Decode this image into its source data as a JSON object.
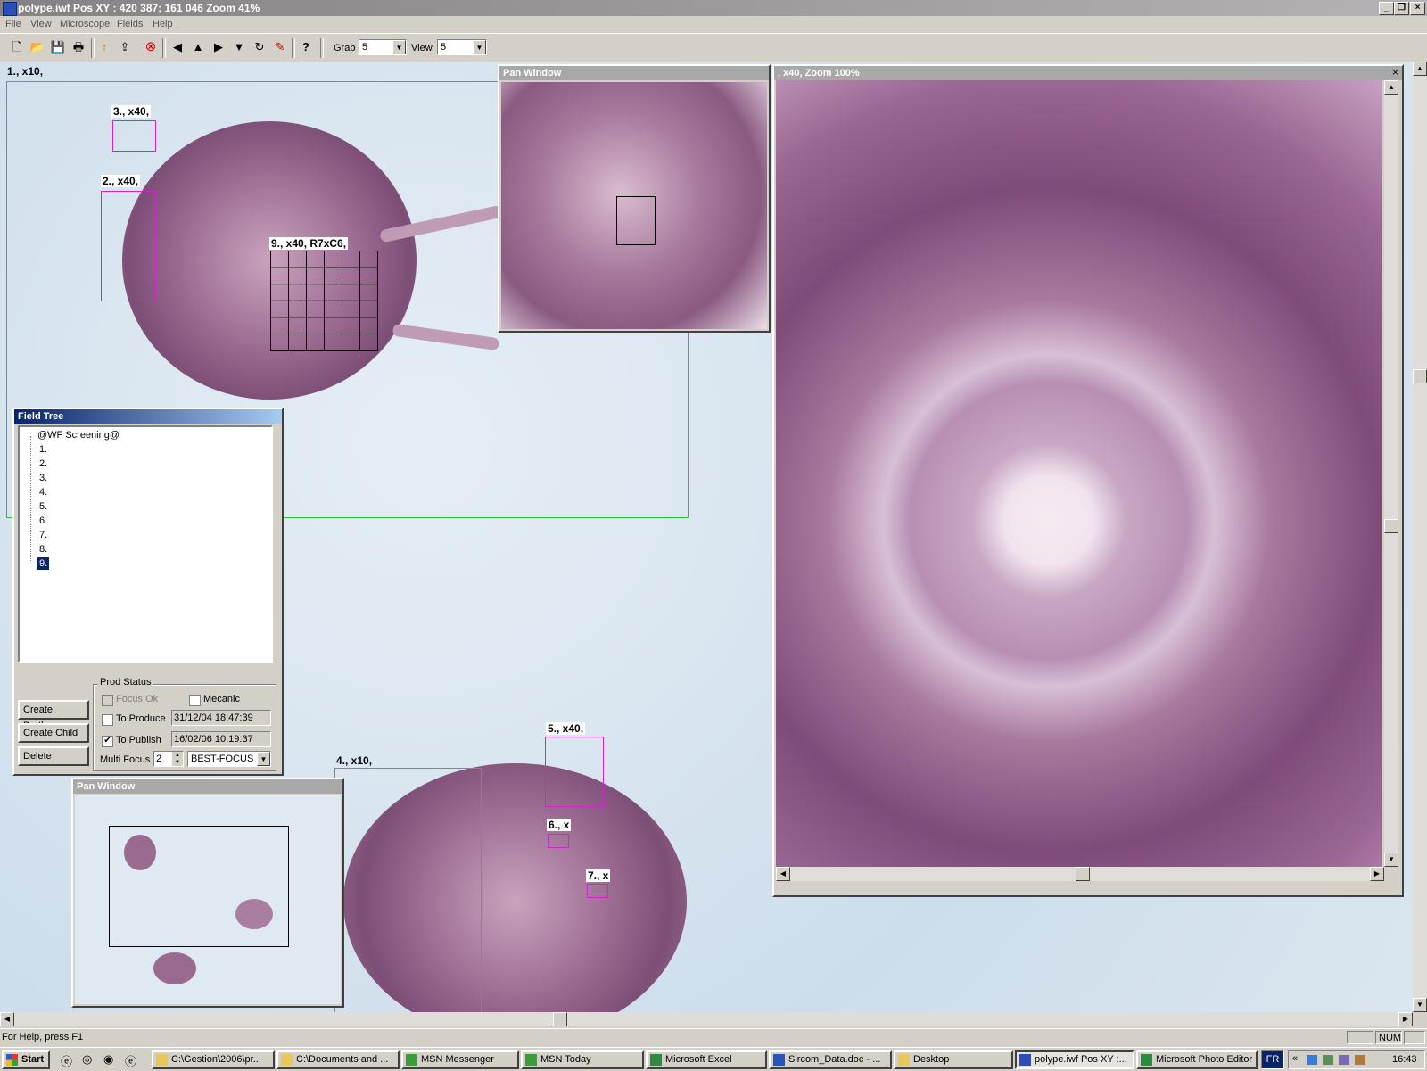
{
  "app": {
    "title": "polype.iwf Pos XY : 420 387; 161 046 Zoom 41%",
    "min_glyph": "_",
    "max_glyph": "❐",
    "close_glyph": "×"
  },
  "menu": [
    "File",
    "View",
    "Microscope",
    "Fields",
    "Help"
  ],
  "toolbar": {
    "icons": [
      "new-icon",
      "open-icon",
      "save-icon",
      "print-icon",
      "arrow-up-icon",
      "export-icon",
      "stop-icon",
      "left-arrow-icon",
      "focus-icon",
      "right-arrow-icon",
      "filter-icon",
      "refresh-icon",
      "tag-icon",
      "help-icon"
    ],
    "glyphs": [
      "🗋",
      "📂",
      "💾",
      "🖶",
      "↑",
      "⇪",
      "⊗",
      "◀",
      "▲",
      "▶",
      "▼",
      "↻",
      "✎",
      "?"
    ],
    "grab_label": "Grab",
    "grab_value": "5",
    "view_label": "View",
    "view_value": "5"
  },
  "fields": {
    "f1": "1., x10,",
    "f2": "2., x40,",
    "f3": "3., x40,",
    "f4": "4., x10,",
    "f5": "5., x40,",
    "f6": "6., x",
    "f7": "7., x",
    "f9": "9., x40, R7xC6,"
  },
  "pan_window_top": {
    "title": "Pan Window"
  },
  "pan_window_bottom": {
    "title": "Pan Window"
  },
  "zoom_window": {
    "title": ", x40, Zoom 100%"
  },
  "field_tree": {
    "title": "Field Tree",
    "root": "@WF Screening@",
    "items": [
      "1.",
      "2.",
      "3.",
      "4.",
      "5.",
      "6.",
      "7.",
      "8.",
      "9."
    ],
    "selected": "9.",
    "buttons": {
      "create_brother": "Create Brother",
      "create_child": "Create Child",
      "delete": "Delete"
    },
    "prod_status": {
      "label": "Prod Status",
      "focus_ok": "Focus Ok",
      "mecanic": "Mecanic",
      "to_produce": "To Produce",
      "to_produce_date": "31/12/04 18:47:39",
      "to_publish": "To Publish",
      "to_publish_date": "16/02/06 10:19:37",
      "multi_focus_label": "Multi Focus",
      "multi_focus_value": "2",
      "focus_mode": "BEST-FOCUS",
      "check_glyph": "✔"
    }
  },
  "statusbar": {
    "help": "For Help, press F1",
    "num": "NUM"
  },
  "taskbar": {
    "start": "Start",
    "tasks": [
      "C:\\Gestion\\2006\\pr...",
      "C:\\Documents and ...",
      "MSN Messenger",
      "MSN Today",
      "Microsoft Excel",
      "Sircom_Data.doc - ...",
      "Desktop",
      "polype.iwf Pos XY :...",
      "Microsoft Photo Editor"
    ],
    "lang": "FR",
    "clock": "16:43"
  },
  "colors": {
    "field_box": "#d025c8",
    "field_region": "#27c33a",
    "selection": "#0a246a"
  }
}
